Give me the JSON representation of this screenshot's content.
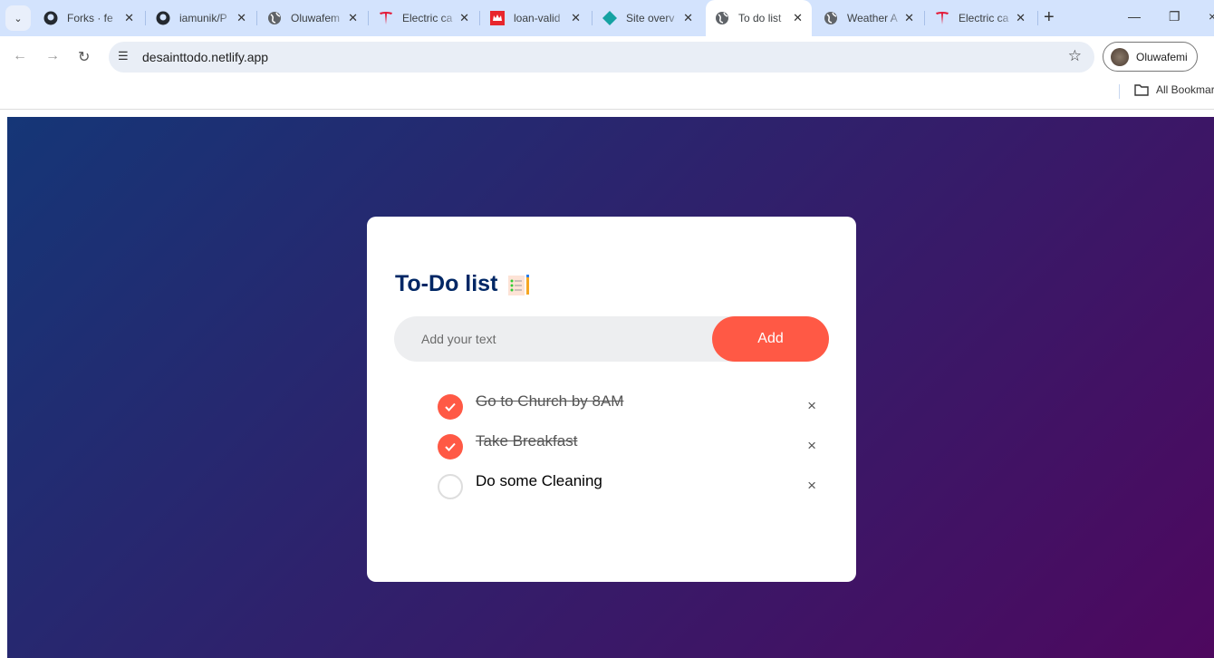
{
  "browser": {
    "tabs": [
      {
        "title": "Forks · fe",
        "icon": "github-icon"
      },
      {
        "title": "iamunik/P",
        "icon": "github-icon"
      },
      {
        "title": "Oluwafem",
        "icon": "globe-icon"
      },
      {
        "title": "Electric ca",
        "icon": "tesla-icon"
      },
      {
        "title": "loan-valid",
        "icon": "crown-icon"
      },
      {
        "title": "Site overv",
        "icon": "netlify-icon"
      },
      {
        "title": "To do list",
        "icon": "globe-icon",
        "active": true
      },
      {
        "title": "Weather A",
        "icon": "globe-icon"
      },
      {
        "title": "Electric ca",
        "icon": "tesla-icon"
      }
    ],
    "url": "desainttodo.netlify.app",
    "profile": "Oluwafemi",
    "bookmarks": "All Bookmarks"
  },
  "app": {
    "title": "To-Do list",
    "input_placeholder": "Add your text",
    "input_value": "",
    "add_label": "Add",
    "todos": [
      {
        "text": "Go to Church by 8AM",
        "done": true
      },
      {
        "text": "Take Breakfast",
        "done": true
      },
      {
        "text": "Do some Cleaning",
        "done": false
      }
    ],
    "delete_glyph": "×",
    "colors": {
      "accent": "#ff5945",
      "title": "#002765",
      "bg_start": "#153677",
      "bg_end": "#4e085f"
    }
  }
}
